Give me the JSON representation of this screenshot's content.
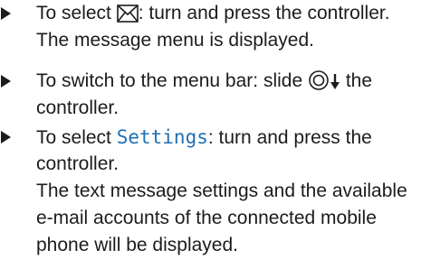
{
  "steps": [
    {
      "line1_before": "To select ",
      "icon1": "envelope-icon",
      "line1_after": ": turn and press the controller.",
      "line2": "The message menu is displayed."
    },
    {
      "line1_before": "To switch to the menu bar: slide ",
      "icon1": "controller-icon",
      "icon2": "arrow-down-icon",
      "line1_after": " the",
      "line2": "controller."
    },
    {
      "line1_before": "To select ",
      "highlight": "Settings",
      "line1_after": ": turn and press the",
      "line2": "controller.",
      "line3": "The text message settings and the available",
      "line4": "e-mail accounts of the connected mobile",
      "line5": "phone will be displayed."
    }
  ],
  "colors": {
    "text": "#1c1c1c",
    "highlight": "#1f6fb5"
  }
}
